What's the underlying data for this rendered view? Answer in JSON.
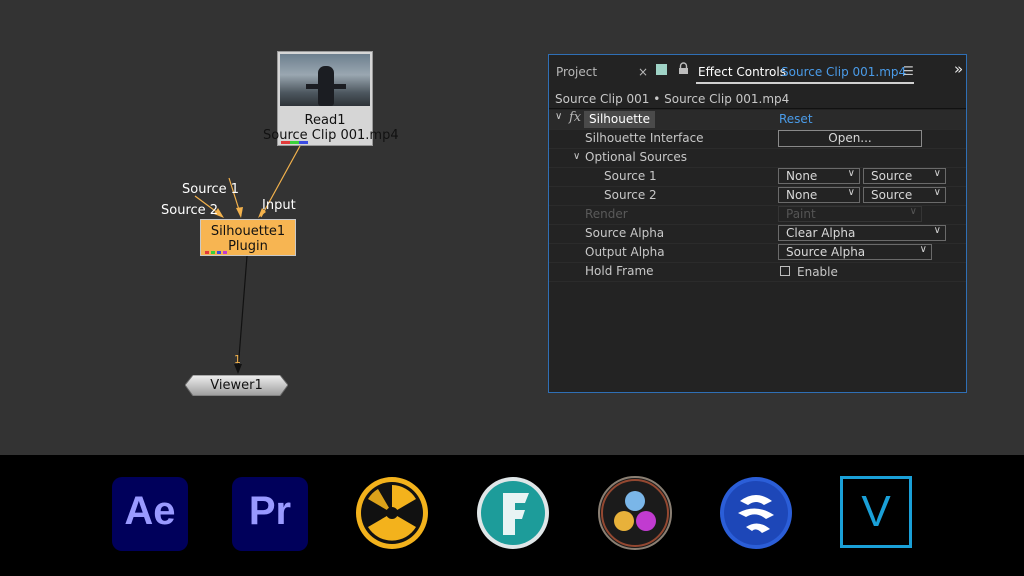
{
  "node_graph": {
    "read_node": {
      "title": "Read1",
      "file": "Source Clip 001.mp4"
    },
    "silhouette_node": {
      "title": "Silhouette1",
      "subtitle": "Plugin"
    },
    "viewer_node": {
      "title": "Viewer1",
      "input_label": "1"
    },
    "input_labels": {
      "source1": "Source 1",
      "source2": "Source 2",
      "input": "Input"
    },
    "colors": {
      "wire": "#f3b24c",
      "node_orange": "#f7b552"
    }
  },
  "effect_controls": {
    "tabs": {
      "project": "Project",
      "close": "×",
      "effect_controls": "Effect Controls",
      "clip": "Source Clip 001.mp4",
      "menu": "☰",
      "expand": "»"
    },
    "breadcrumb": "Source Clip 001 • Source Clip 001.mp4",
    "effect": {
      "fx": "fx",
      "name": "Silhouette",
      "reset": "Reset"
    },
    "rows": {
      "interface": {
        "label": "Silhouette Interface",
        "button": "Open..."
      },
      "optional": {
        "label": "Optional Sources"
      },
      "source1": {
        "label": "Source 1",
        "value1": "None",
        "value2": "Source"
      },
      "source2": {
        "label": "Source 2",
        "value1": "None",
        "value2": "Source"
      },
      "render": {
        "label": "Render",
        "value": "Paint"
      },
      "source_alpha": {
        "label": "Source Alpha",
        "value": "Clear Alpha"
      },
      "output_alpha": {
        "label": "Output Alpha",
        "value": "Source Alpha"
      },
      "hold_frame": {
        "label": "Hold Frame",
        "checkbox": "Enable"
      }
    },
    "colors": {
      "accent": "#2f6fb5",
      "link": "#4a9be8"
    }
  },
  "dock": {
    "after_effects": "Ae",
    "premiere": "Pr",
    "fusion": "F",
    "vegas": "V"
  }
}
